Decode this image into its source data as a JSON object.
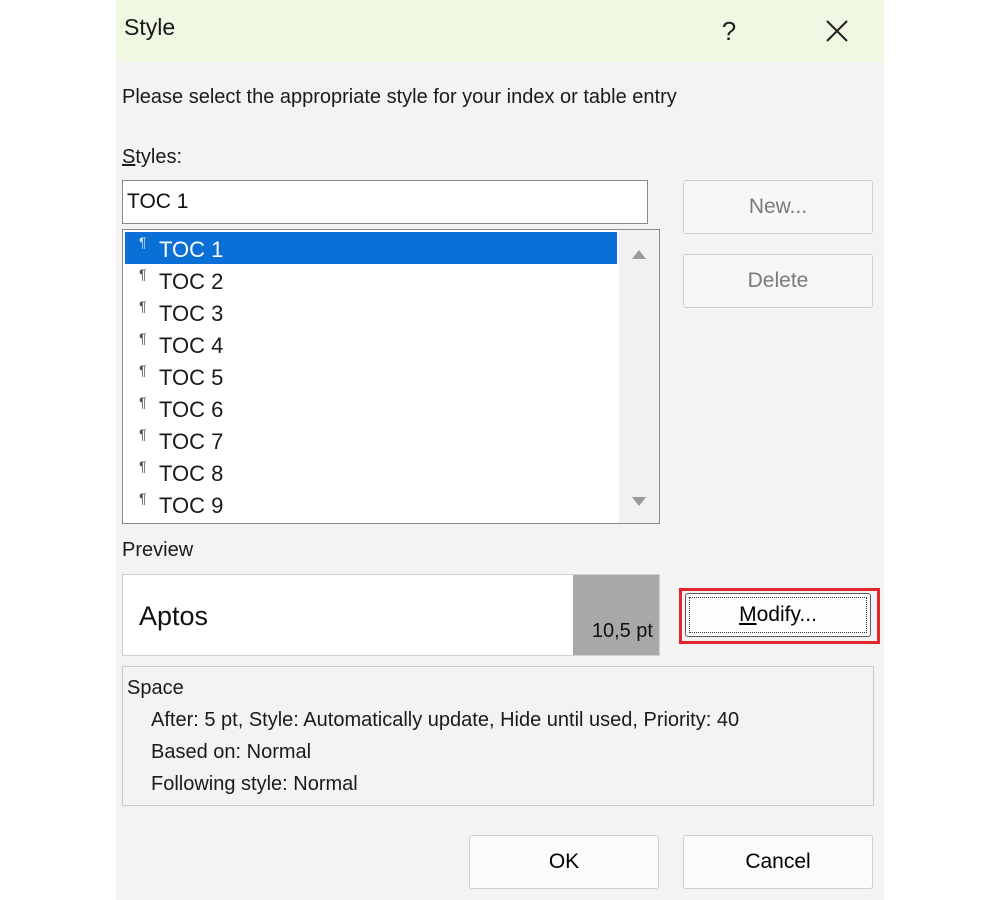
{
  "window": {
    "title": "Style",
    "help_label": "?",
    "close_icon": "close-icon"
  },
  "instruction": "Please select the appropriate style for your index or table entry",
  "styles": {
    "label_mnemonic": "S",
    "label_rest": "tyles:",
    "current_value": "TOC 1",
    "items": [
      {
        "label": "TOC 1",
        "selected": true
      },
      {
        "label": "TOC 2",
        "selected": false
      },
      {
        "label": "TOC 3",
        "selected": false
      },
      {
        "label": "TOC 4",
        "selected": false
      },
      {
        "label": "TOC 5",
        "selected": false
      },
      {
        "label": "TOC 6",
        "selected": false
      },
      {
        "label": "TOC 7",
        "selected": false
      },
      {
        "label": "TOC 8",
        "selected": false
      },
      {
        "label": "TOC 9",
        "selected": false
      }
    ],
    "item_icon": "paragraph-icon"
  },
  "buttons": {
    "new_label": "New...",
    "delete_label": "Delete",
    "modify_mnemonic": "M",
    "modify_rest": "odify...",
    "ok_label": "OK",
    "cancel_label": "Cancel"
  },
  "preview": {
    "label": "Preview",
    "font_name": "Aptos",
    "font_size": "10,5 pt"
  },
  "description": {
    "heading": "Space",
    "lines": [
      "After:  5 pt, Style: Automatically update, Hide until used, Priority: 40",
      "Based on: Normal",
      "Following style: Normal"
    ]
  },
  "colors": {
    "titlebar": "#f0f7e2",
    "selection": "#0a6fd6",
    "highlight": "#e2242b"
  }
}
